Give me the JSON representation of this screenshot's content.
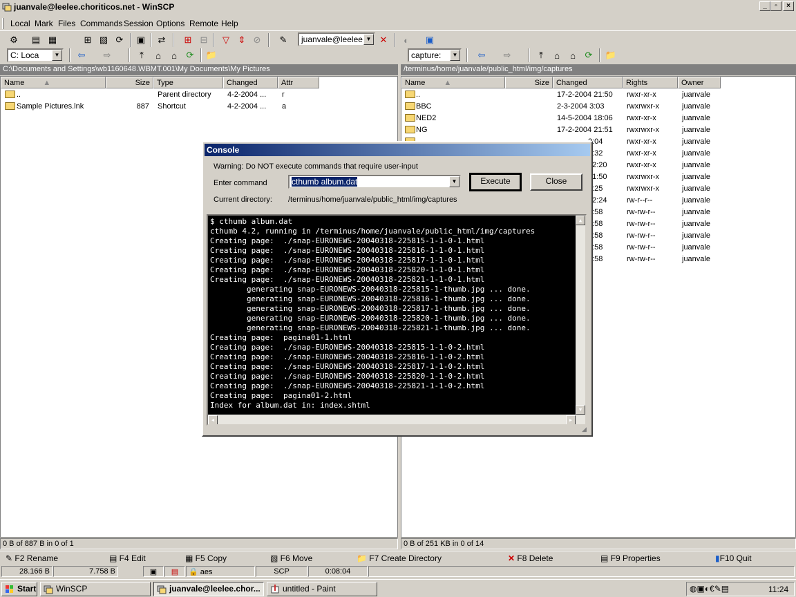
{
  "window": {
    "title": "juanvale@leelee.choriticos.net - WinSCP"
  },
  "menu": [
    "Local",
    "Mark",
    "Files",
    "Commands",
    "Session",
    "Options",
    "Remote",
    "Help"
  ],
  "toolbar": {
    "session_combo": "juanvale@leelee.c"
  },
  "local": {
    "drive": "C: Loca",
    "path": "C:\\Documents and Settings\\wb1160648.WBMT.001\\My Documents\\My Pictures",
    "columns": [
      "Name",
      "Size",
      "Type",
      "Changed",
      "Attr"
    ],
    "rows": [
      {
        "name": "..",
        "size": "",
        "type": "Parent directory",
        "changed": "4-2-2004  ...",
        "attr": "r"
      },
      {
        "name": "Sample Pictures.lnk",
        "size": "887",
        "type": "Shortcut",
        "changed": "4-2-2004  ...",
        "attr": "a"
      }
    ],
    "status": "0 B of 887 B in 0 of 1"
  },
  "remote": {
    "dir_combo": "capture:",
    "path": "/terminus/home/juanvale/public_html/img/captures",
    "columns": [
      "Name",
      "Size",
      "Changed",
      "Rights",
      "Owner"
    ],
    "rows": [
      {
        "name": "..",
        "size": "",
        "changed": "17-2-2004 21:50",
        "rights": "rwxr-xr-x",
        "owner": "juanvale"
      },
      {
        "name": "BBC",
        "size": "",
        "changed": "2-3-2004 3:03",
        "rights": "rwxrwxr-x",
        "owner": "juanvale"
      },
      {
        "name": "NED2",
        "size": "",
        "changed": "14-5-2004 18:06",
        "rights": "rwxr-xr-x",
        "owner": "juanvale"
      },
      {
        "name": "NG",
        "size": "",
        "changed": "17-2-2004 21:51",
        "rights": "rwxrwxr-x",
        "owner": "juanvale"
      },
      {
        "name": "",
        "size": "",
        "changed": "2:04",
        "rights": "rwxr-xr-x",
        "owner": "juanvale"
      },
      {
        "name": "",
        "size": "",
        "changed": "2:32",
        "rights": "rwxr-xr-x",
        "owner": "juanvale"
      },
      {
        "name": "",
        "size": "",
        "changed": "12:20",
        "rights": "rwxr-xr-x",
        "owner": "juanvale"
      },
      {
        "name": "",
        "size": "",
        "changed": "21:50",
        "rights": "rwxrwxr-x",
        "owner": "juanvale"
      },
      {
        "name": "",
        "size": "",
        "changed": "0:25",
        "rights": "rwxrwxr-x",
        "owner": "juanvale"
      },
      {
        "name": "",
        "size": "",
        "changed": "12:24",
        "rights": "rw-r--r--",
        "owner": "juanvale"
      },
      {
        "name": "",
        "size": "",
        "changed": "0:58",
        "rights": "rw-rw-r--",
        "owner": "juanvale"
      },
      {
        "name": "",
        "size": "",
        "changed": "0:58",
        "rights": "rw-rw-r--",
        "owner": "juanvale"
      },
      {
        "name": "",
        "size": "",
        "changed": "0:58",
        "rights": "rw-rw-r--",
        "owner": "juanvale"
      },
      {
        "name": "",
        "size": "",
        "changed": "0:58",
        "rights": "rw-rw-r--",
        "owner": "juanvale"
      },
      {
        "name": "",
        "size": "",
        "changed": "0:58",
        "rights": "rw-rw-r--",
        "owner": "juanvale"
      }
    ],
    "status": "0 B of 251 KB in 0 of 14"
  },
  "console": {
    "title": "Console",
    "warning": "Warning: Do NOT execute commands that require user-input",
    "command_label": "Enter command",
    "command_value": "cthumb album.dat",
    "execute": "Execute",
    "close": "Close",
    "dir_label": "Current directory:",
    "dir_value": "/terminus/home/juanvale/public_html/img/captures",
    "output": [
      "$ cthumb album.dat",
      "cthumb 4.2, running in /terminus/home/juanvale/public_html/img/captures",
      "Creating page:  ./snap-EURONEWS-20040318-225815-1-1-0-1.html",
      "Creating page:  ./snap-EURONEWS-20040318-225816-1-1-0-1.html",
      "Creating page:  ./snap-EURONEWS-20040318-225817-1-1-0-1.html",
      "Creating page:  ./snap-EURONEWS-20040318-225820-1-1-0-1.html",
      "Creating page:  ./snap-EURONEWS-20040318-225821-1-1-0-1.html",
      "        generating snap-EURONEWS-20040318-225815-1-thumb.jpg ... done.",
      "        generating snap-EURONEWS-20040318-225816-1-thumb.jpg ... done.",
      "        generating snap-EURONEWS-20040318-225817-1-thumb.jpg ... done.",
      "        generating snap-EURONEWS-20040318-225820-1-thumb.jpg ... done.",
      "        generating snap-EURONEWS-20040318-225821-1-thumb.jpg ... done.",
      "Creating page:  pagina01-1.html",
      "Creating page:  ./snap-EURONEWS-20040318-225815-1-1-0-2.html",
      "Creating page:  ./snap-EURONEWS-20040318-225816-1-1-0-2.html",
      "Creating page:  ./snap-EURONEWS-20040318-225817-1-1-0-2.html",
      "Creating page:  ./snap-EURONEWS-20040318-225820-1-1-0-2.html",
      "Creating page:  ./snap-EURONEWS-20040318-225821-1-1-0-2.html",
      "Creating page:  pagina01-2.html",
      "Index for album.dat in: index.shtml"
    ]
  },
  "fkeys": [
    "F2 Rename",
    "F4 Edit",
    "F5 Copy",
    "F6 Move",
    "F7 Create Directory",
    "F8 Delete",
    "F9 Properties",
    "F10 Quit"
  ],
  "bottom_status": {
    "uploaded": "28.166 B",
    "downloaded": "7.758 B",
    "cipher": "aes",
    "protocol": "SCP",
    "time": "0:08:04"
  },
  "taskbar": {
    "start": "Start",
    "items": [
      "WinSCP",
      "juanvale@leelee.chor...",
      "untitled - Paint"
    ],
    "clock": "11:24"
  }
}
